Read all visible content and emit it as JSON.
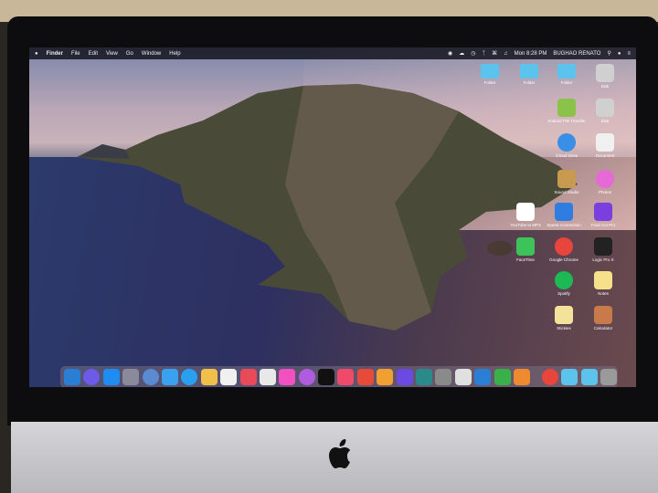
{
  "menubar": {
    "apple": "",
    "app": "Finder",
    "items": [
      "File",
      "Edit",
      "View",
      "Go",
      "Window",
      "Help"
    ],
    "clock": "Mon 8:28 PM",
    "user": "BUGHAO RENATO"
  },
  "desktop_icons": [
    {
      "label": "Folder",
      "icon": "folder-icon",
      "color": "#5cc4ec"
    },
    {
      "label": "Folder",
      "icon": "folder-icon",
      "color": "#5cc4ec"
    },
    {
      "label": "Folder",
      "icon": "folder-icon",
      "color": "#5cc4ec"
    },
    {
      "label": "Disk",
      "icon": "external-drive-icon",
      "color": "#d0d0d0"
    },
    {
      "label": "Android File Transfer",
      "icon": "android-icon",
      "color": "#8bc34a"
    },
    {
      "label": "Disk",
      "icon": "external-drive-icon",
      "color": "#d0d0d0"
    },
    {
      "label": "iCloud Drive",
      "icon": "icloud-icon",
      "color": "#3a8ee6"
    },
    {
      "label": "Document",
      "icon": "document-icon",
      "color": "#f0f0f0"
    },
    {
      "label": "Sound Studio",
      "icon": "guitar-icon",
      "color": "#c89a50"
    },
    {
      "label": "Photos",
      "icon": "color-wheel-icon",
      "color": "#e56ad8"
    },
    {
      "label": "YouTube to MP3",
      "icon": "microphone-icon",
      "color": "#ffffff"
    },
    {
      "label": "Sparta Connection",
      "icon": "phone-sync-icon",
      "color": "#2f7de0"
    },
    {
      "label": "Final Cut Pro",
      "icon": "clapper-icon",
      "color": "#7b3fe0"
    },
    {
      "label": "FaceTime",
      "icon": "facetime-icon",
      "color": "#3cc45a"
    },
    {
      "label": "Google Chrome",
      "icon": "chrome-icon",
      "color": "#e8453c"
    },
    {
      "label": "Logic Pro X",
      "icon": "logic-icon",
      "color": "#222222"
    },
    {
      "label": "Spotify",
      "icon": "spotify-icon",
      "color": "#1db954"
    },
    {
      "label": "Notes",
      "icon": "notes-icon",
      "color": "#f7e08a"
    },
    {
      "label": "Stickies",
      "icon": "stickies-icon",
      "color": "#f3e39a"
    },
    {
      "label": "Calculator",
      "icon": "calculator-icon",
      "color": "#c87a4a"
    }
  ],
  "dock": [
    "#2a7fd4",
    "#6b5be6",
    "#1e8cf0",
    "#8a8a9a",
    "#5a8ad0",
    "#3aa0f0",
    "#2a9ff0",
    "#f0c04a",
    "#f0f0f0",
    "#e84a5a",
    "#e8e8e8",
    "#f050c0",
    "#b05ce0",
    "#111111",
    "#f04a6a",
    "#e84a3a",
    "#f0a030",
    "#6a4ae0",
    "#2a8a8a",
    "#8a8a8a",
    "#e0e0e0",
    "#2a7fd4",
    "#3ab04a",
    "#f08a30",
    "#e8453c",
    "#5cc4ec",
    "#5cc4ec",
    "#9a9a9a"
  ]
}
